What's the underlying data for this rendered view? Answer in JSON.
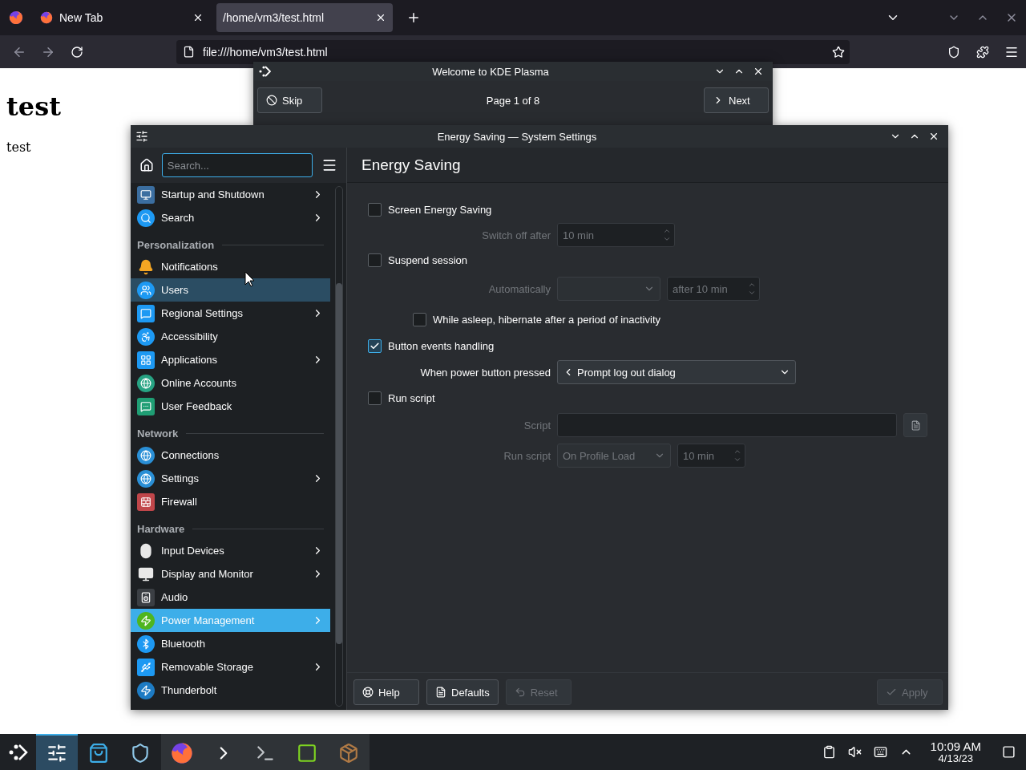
{
  "browser": {
    "tabs": [
      {
        "label": "New Tab",
        "selected": false,
        "has_favicon": true
      },
      {
        "label": "/home/vm3/test.html",
        "selected": true,
        "has_favicon": false
      }
    ],
    "url": "file:///home/vm3/test.html",
    "page": {
      "heading": "test",
      "paragraph": "test"
    }
  },
  "welcome_window": {
    "title": "Welcome to KDE Plasma",
    "skip": "Skip",
    "page_indicator": "Page 1 of 8",
    "next": "Next"
  },
  "settings_window": {
    "title": "Energy Saving — System Settings",
    "search": {
      "placeholder": "Search..."
    },
    "sidebar": {
      "sections": [
        {
          "items": [
            {
              "label": "Startup and Shutdown",
              "has_submenu": true,
              "selected": false,
              "hovered": false
            },
            {
              "label": "Search",
              "has_submenu": true,
              "selected": false,
              "hovered": false
            }
          ]
        },
        {
          "title": "Personalization",
          "items": [
            {
              "label": "Notifications",
              "has_submenu": false,
              "selected": false,
              "hovered": false
            },
            {
              "label": "Users",
              "has_submenu": false,
              "selected": false,
              "hovered": true
            },
            {
              "label": "Regional Settings",
              "has_submenu": true,
              "selected": false,
              "hovered": false
            },
            {
              "label": "Accessibility",
              "has_submenu": false,
              "selected": false,
              "hovered": false
            },
            {
              "label": "Applications",
              "has_submenu": true,
              "selected": false,
              "hovered": false
            },
            {
              "label": "Online Accounts",
              "has_submenu": false,
              "selected": false,
              "hovered": false
            },
            {
              "label": "User Feedback",
              "has_submenu": false,
              "selected": false,
              "hovered": false
            }
          ]
        },
        {
          "title": "Network",
          "items": [
            {
              "label": "Connections",
              "has_submenu": false,
              "selected": false,
              "hovered": false
            },
            {
              "label": "Settings",
              "has_submenu": true,
              "selected": false,
              "hovered": false
            },
            {
              "label": "Firewall",
              "has_submenu": false,
              "selected": false,
              "hovered": false
            }
          ]
        },
        {
          "title": "Hardware",
          "items": [
            {
              "label": "Input Devices",
              "has_submenu": true,
              "selected": false,
              "hovered": false
            },
            {
              "label": "Display and Monitor",
              "has_submenu": true,
              "selected": false,
              "hovered": false
            },
            {
              "label": "Audio",
              "has_submenu": false,
              "selected": false,
              "hovered": false
            },
            {
              "label": "Power Management",
              "has_submenu": true,
              "selected": true,
              "hovered": false
            },
            {
              "label": "Bluetooth",
              "has_submenu": false,
              "selected": false,
              "hovered": false
            },
            {
              "label": "Removable Storage",
              "has_submenu": true,
              "selected": false,
              "hovered": false
            },
            {
              "label": "Thunderbolt",
              "has_submenu": false,
              "selected": false,
              "hovered": false
            }
          ]
        }
      ]
    },
    "page_title": "Energy Saving",
    "rows": [
      {
        "kind": "check",
        "label": "Screen Energy Saving",
        "checked": false
      },
      {
        "kind": "spin",
        "label": "Switch off after",
        "value": "10 min",
        "disabled": true
      },
      {
        "kind": "check",
        "label": "Suspend session",
        "checked": false
      },
      {
        "kind": "combo-spin",
        "label": "Automatically",
        "spin": "after 10 min",
        "disabled": true
      },
      {
        "kind": "subcheck",
        "label": "While asleep, hibernate after a period of inactivity",
        "checked": false
      },
      {
        "kind": "check",
        "label": "Button events handling",
        "checked": true
      },
      {
        "kind": "combo",
        "label": "When power button pressed",
        "value": "Prompt log out dialog",
        "disabled": false
      },
      {
        "kind": "check",
        "label": "Run script",
        "checked": false
      },
      {
        "kind": "file",
        "label": "Script",
        "disabled": true
      },
      {
        "kind": "combo-spin",
        "label": "Run script",
        "combo": "On Profile Load",
        "spin": "10 min",
        "disabled": true
      }
    ],
    "footer": [
      {
        "kind": "help",
        "label": "Help",
        "disabled": false
      },
      {
        "kind": "defaults",
        "label": "Defaults",
        "disabled": false
      },
      {
        "kind": "reset",
        "label": "Reset",
        "disabled": true
      },
      {
        "kind": "apply",
        "label": "Apply",
        "disabled": true
      }
    ]
  },
  "taskbar": {
    "tasks": [
      {
        "selected": true,
        "running": true
      },
      {
        "selected": false,
        "running": false
      },
      {
        "selected": false,
        "running": false
      },
      {
        "selected": false,
        "running": true
      },
      {
        "selected": false,
        "running": true
      },
      {
        "selected": false,
        "running": true
      },
      {
        "selected": false,
        "running": true
      },
      {
        "selected": false,
        "running": true
      }
    ],
    "clock": {
      "time": "10:09 AM",
      "date": "4/13/23"
    }
  }
}
